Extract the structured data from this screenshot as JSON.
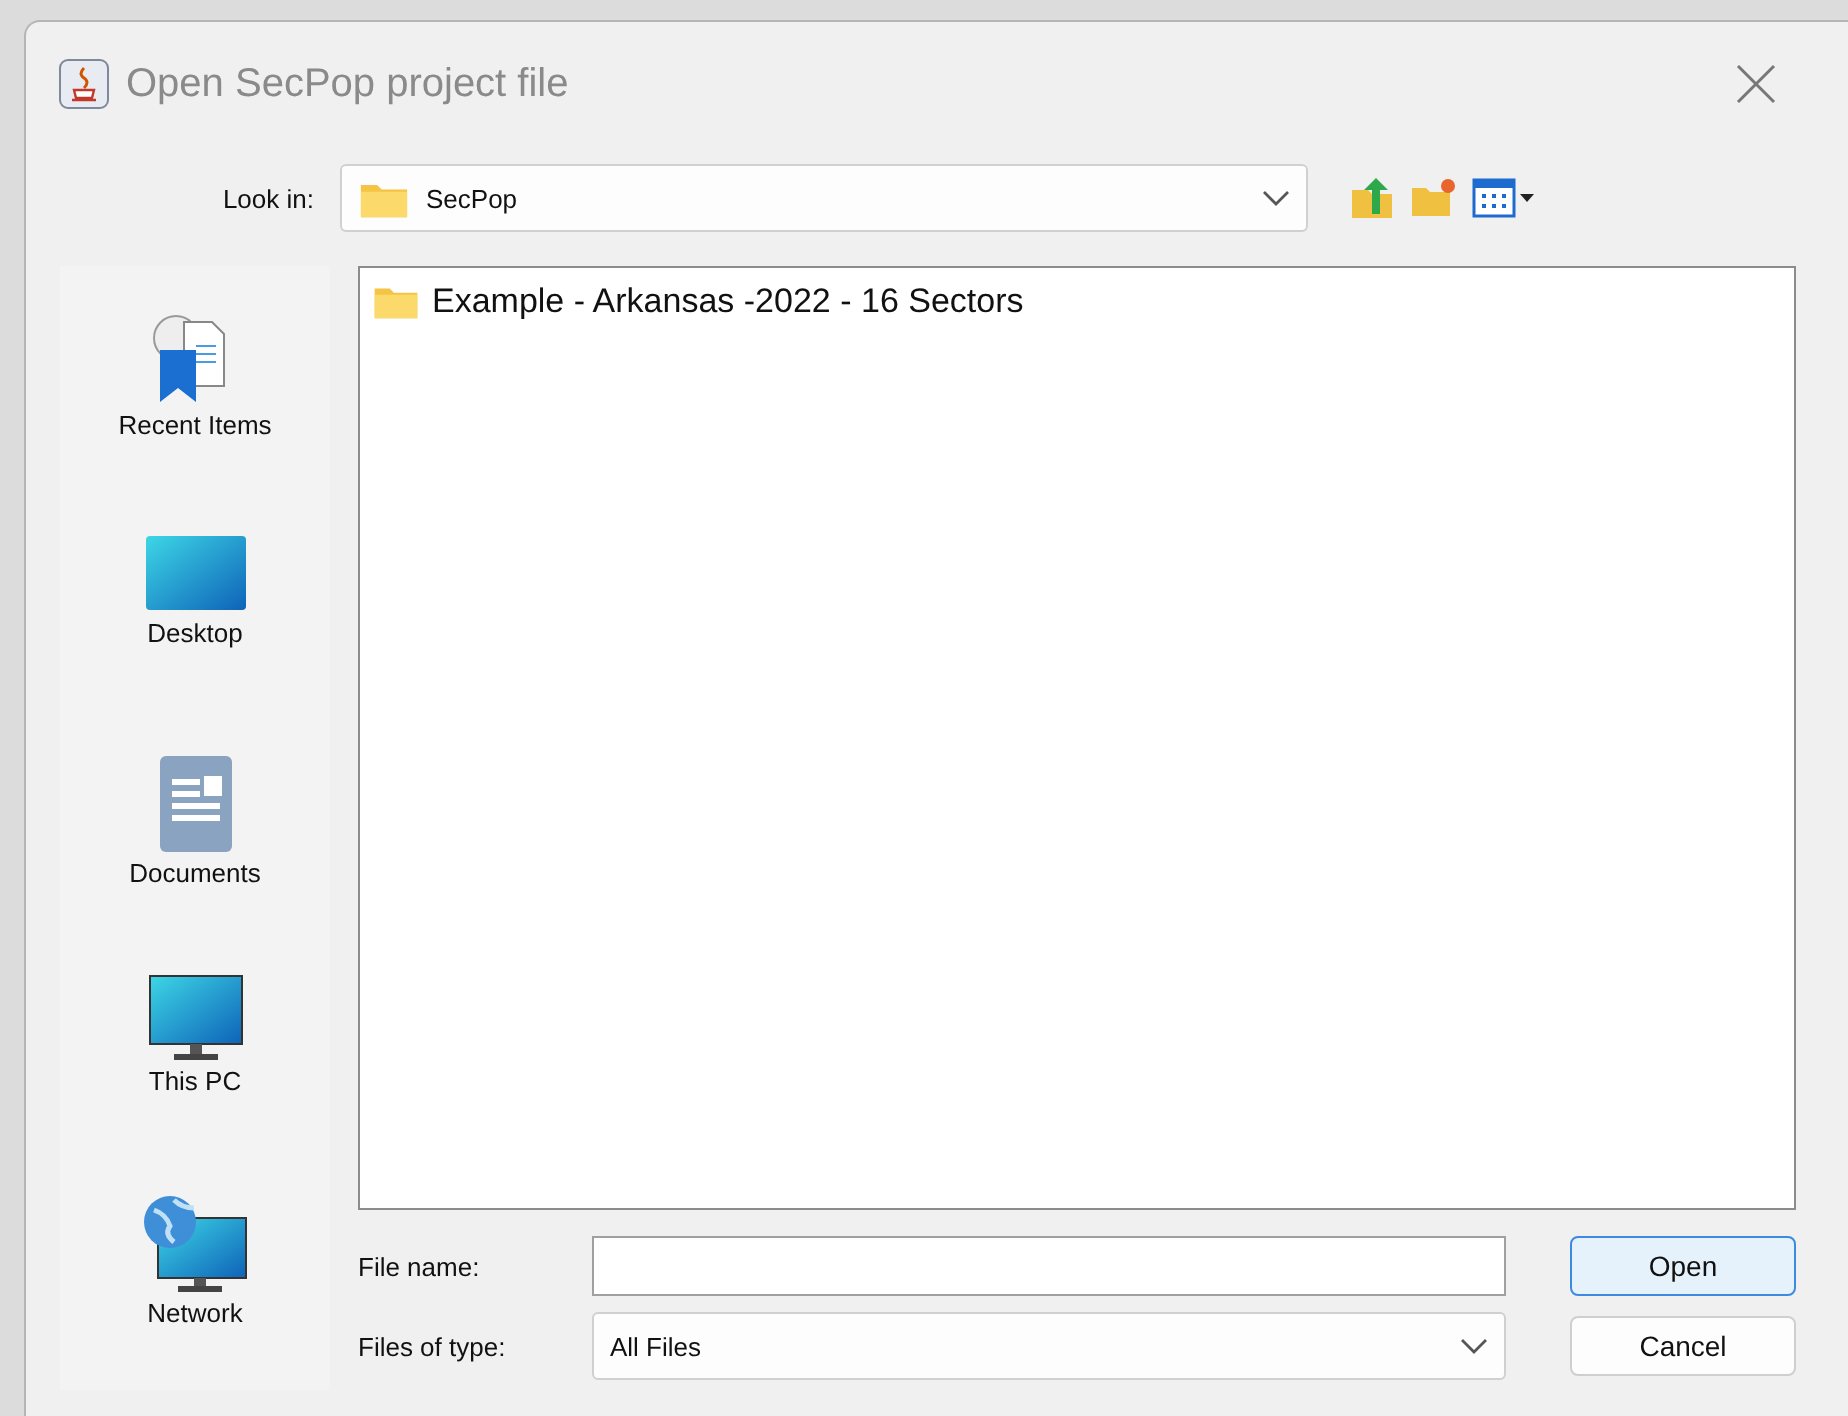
{
  "window": {
    "title": "Open SecPop project file"
  },
  "look_in": {
    "label": "Look in:",
    "value": "SecPop"
  },
  "places": [
    {
      "kind": "recent",
      "label": "Recent Items"
    },
    {
      "kind": "desktop",
      "label": "Desktop"
    },
    {
      "kind": "documents",
      "label": "Documents"
    },
    {
      "kind": "pc",
      "label": "This PC"
    },
    {
      "kind": "network",
      "label": "Network"
    }
  ],
  "files": [
    {
      "name": "Example - Arkansas -2022 - 16 Sectors",
      "selected": false
    }
  ],
  "file_name": {
    "label": "File name:"
  },
  "file_type": {
    "label": "Files of type:",
    "value": "All Files"
  },
  "buttons": [
    {
      "label": "Open",
      "default": true
    },
    {
      "label": "Cancel",
      "default": false
    }
  ]
}
